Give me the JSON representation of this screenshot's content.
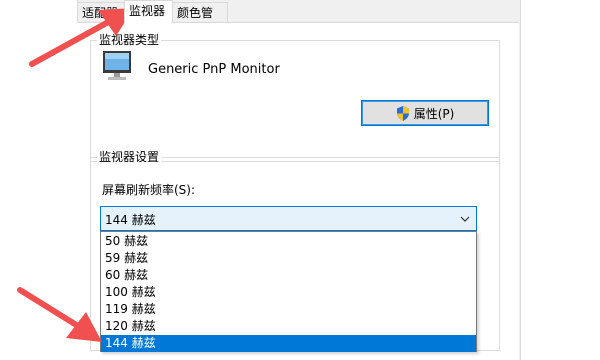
{
  "tabs": [
    {
      "label": "适配器"
    },
    {
      "label": "监视器"
    },
    {
      "label": "颜色管理"
    }
  ],
  "monitor_type": {
    "title": "监视器类型",
    "name": "Generic PnP Monitor",
    "properties_label": "属性(P)"
  },
  "monitor_settings": {
    "title": "监视器设置",
    "refresh_label": "屏幕刷新频率(S):",
    "selected_value": "144 赫兹",
    "options": [
      {
        "label": "50 赫兹"
      },
      {
        "label": "59 赫兹"
      },
      {
        "label": "60 赫兹"
      },
      {
        "label": "100 赫兹"
      },
      {
        "label": "119 赫兹"
      },
      {
        "label": "120 赫兹"
      },
      {
        "label": "144 赫兹"
      }
    ],
    "selected_index": 6
  },
  "colors": {
    "accent": "#0078d7",
    "annotation_arrow": "#f0504f"
  },
  "icons": {
    "monitor": "monitor-icon",
    "shield": "uac-shield-icon",
    "chevron": "chevron-down-icon"
  }
}
